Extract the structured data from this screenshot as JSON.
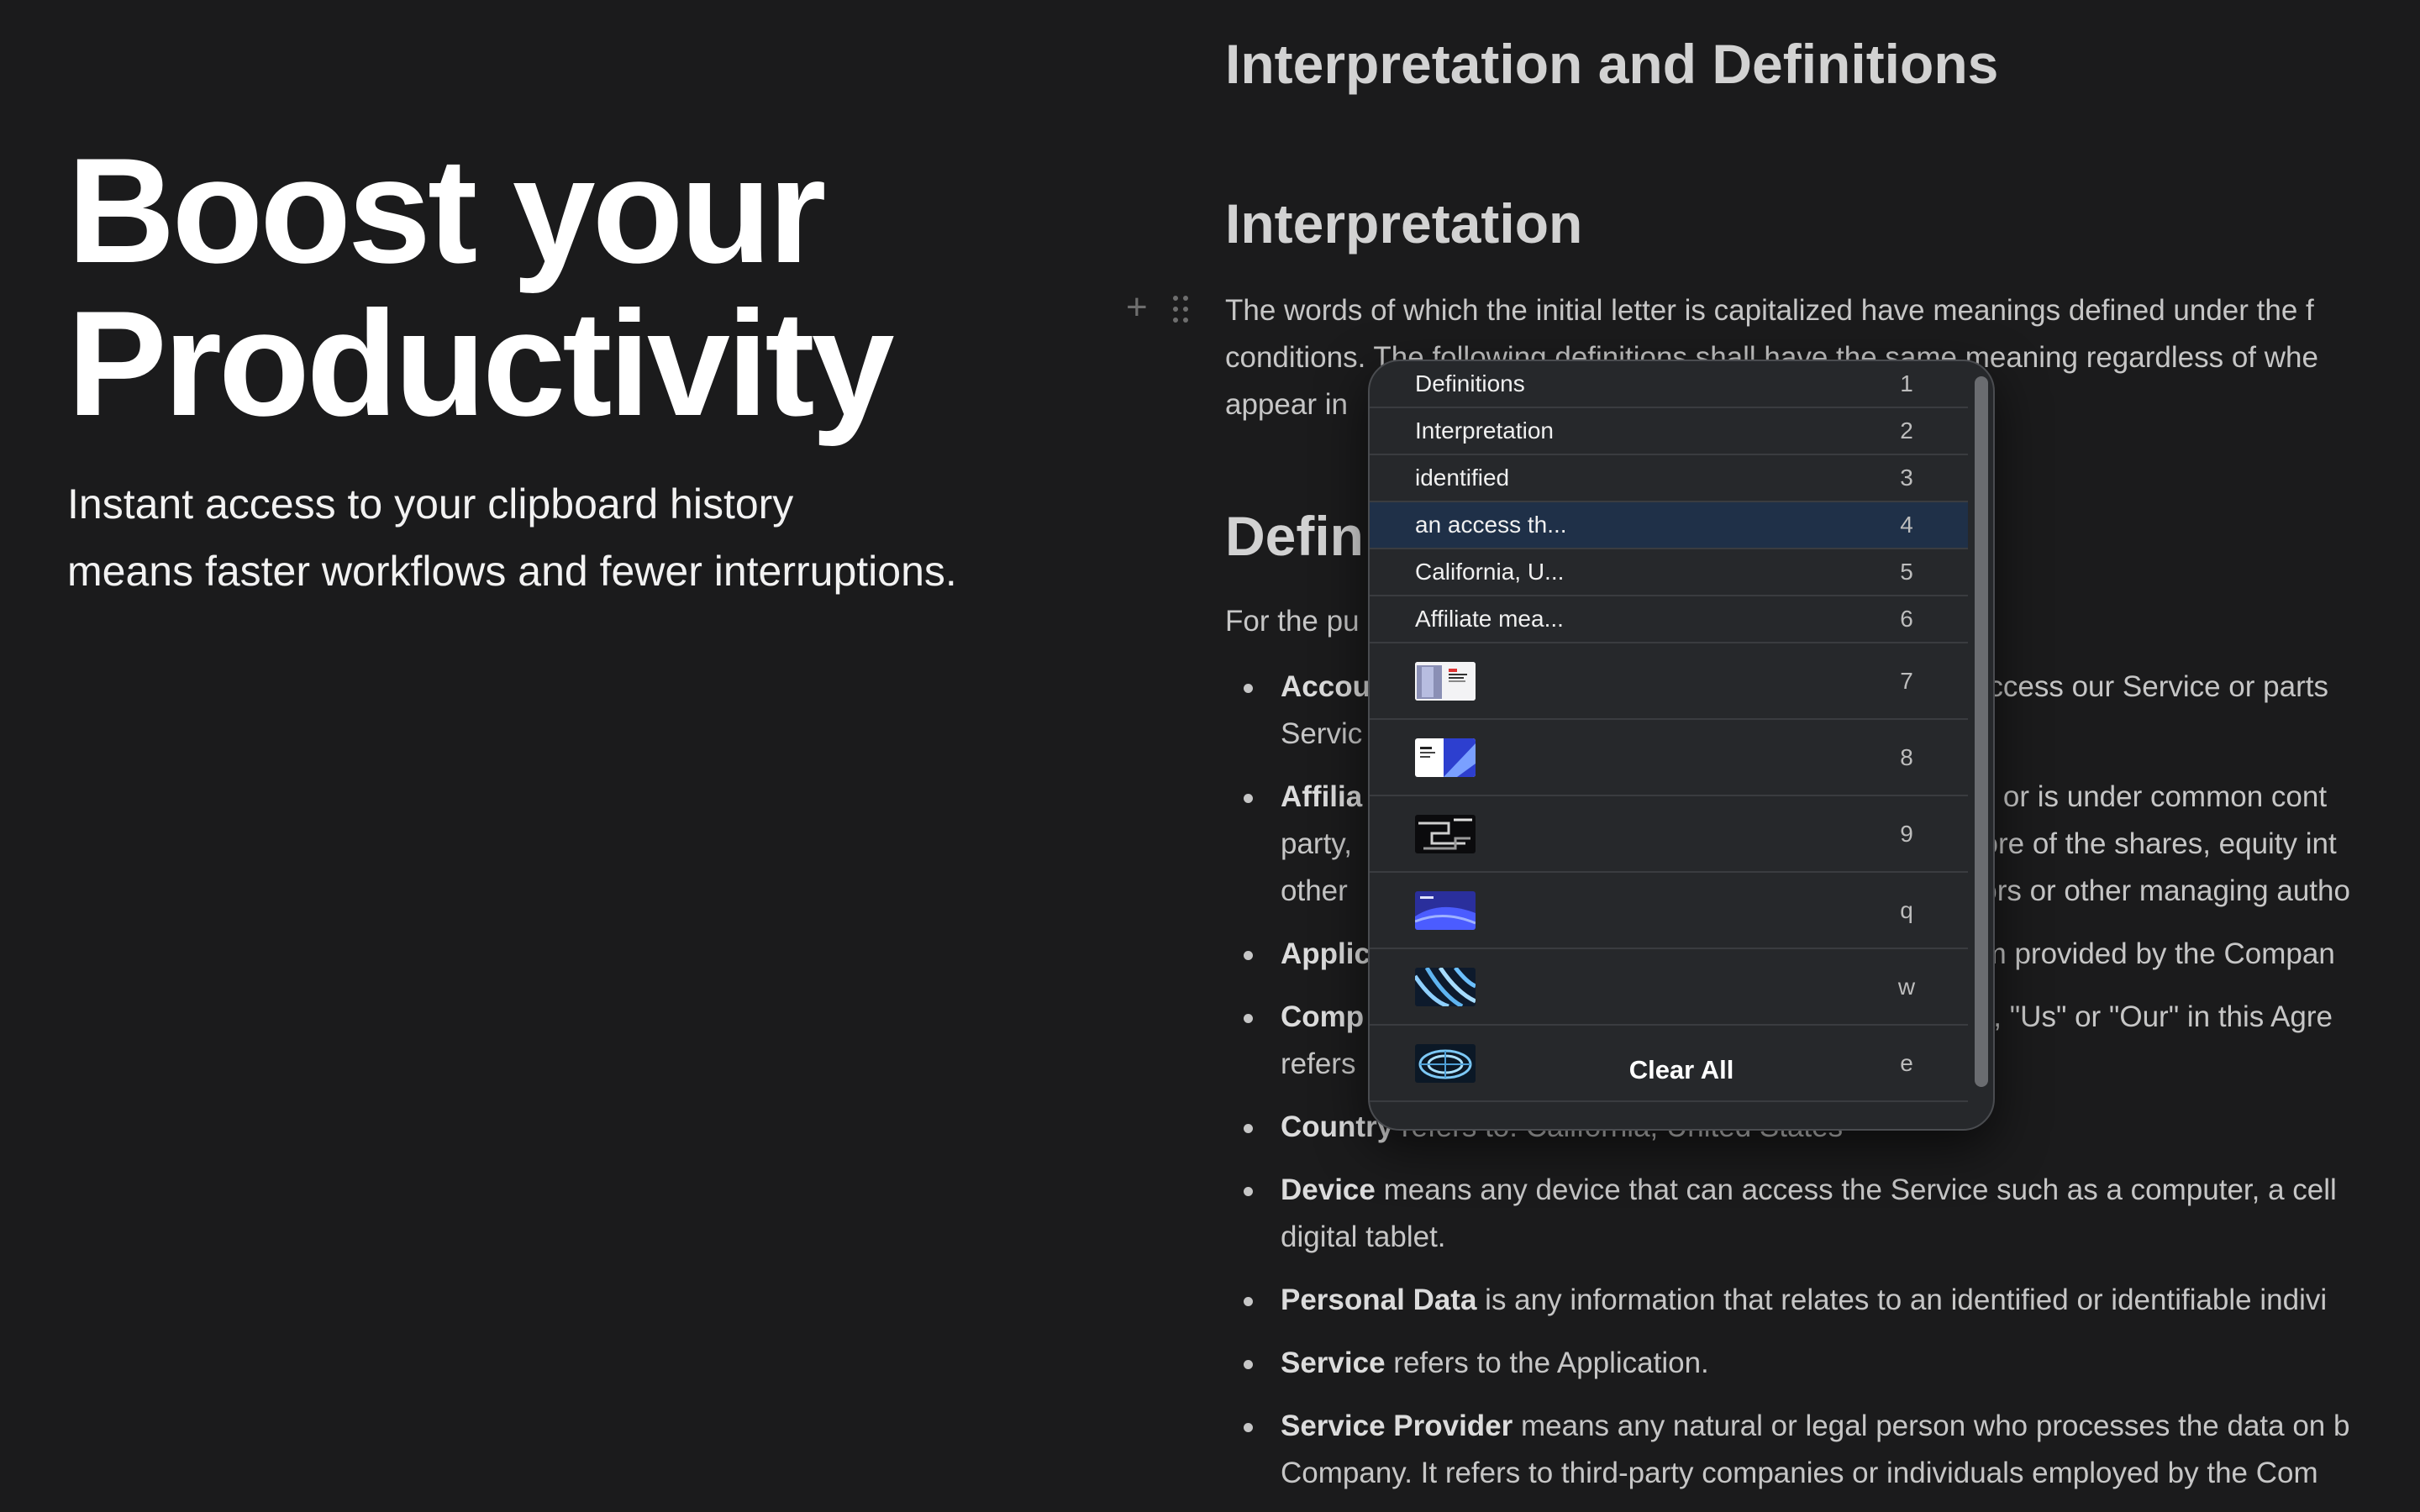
{
  "hero": {
    "title_line1": "Boost your",
    "title_line2": "Productivity",
    "subtitle_line1": "Instant access to your clipboard history",
    "subtitle_line2": "means faster workflows and fewer interruptions."
  },
  "doc": {
    "h1": "Interpretation and Definitions",
    "h2_interpretation": "Interpretation",
    "interpretation_lines": [
      "The words of which the initial letter is capitalized have meanings defined under the f",
      "conditions. The following definitions shall have the same meaning regardless of whe",
      "appear in"
    ],
    "h2_definitions": "Defin",
    "purposes_text": "For the pu",
    "items": [
      {
        "term": "Accou",
        "rest": "",
        "right": "to access our Service or parts",
        "line2": "Servic"
      },
      {
        "term": "Affilia",
        "rest": "",
        "right": "d by or is under common cont",
        "line2": "party,",
        "line2_right": "r more of the shares, equity int",
        "line3": "other",
        "line3_right": "ctors or other managing autho"
      },
      {
        "term": "Applic",
        "rest": "",
        "right": "gram provided by the Compan"
      },
      {
        "term": "Comp",
        "rest": "",
        "right": "We\", \"Us\" or \"Our\" in this Agre",
        "line2": "refers"
      },
      {
        "term": "Country",
        "rest": " refers to: California, United States"
      },
      {
        "term": "Device",
        "rest": " means any device that can access the Service such as a computer, a cell",
        "line2": "digital tablet."
      },
      {
        "term": "Personal Data",
        "rest": " is any information that relates to an identified or identifiable indivi"
      },
      {
        "term": "Service",
        "rest": " refers to the Application."
      },
      {
        "term": "Service Provider",
        "rest": " means any natural or legal person who processes the data on b",
        "line2": "Company. It refers to third-party companies or individuals employed by the Com"
      }
    ]
  },
  "clipboard": {
    "entries": [
      {
        "label": "Definitions",
        "key": "1"
      },
      {
        "label": "Interpretation",
        "key": "2"
      },
      {
        "label": "identified",
        "key": "3"
      },
      {
        "label": "an access th...",
        "key": "4",
        "selected": true
      },
      {
        "label": "California, U...",
        "key": "5"
      },
      {
        "label": "Affiliate mea...",
        "key": "6"
      }
    ],
    "image_entries": [
      {
        "key": "7",
        "thumb": "document-thumbnail"
      },
      {
        "key": "8",
        "thumb": "blue-wave-thumbnail"
      },
      {
        "key": "9",
        "thumb": "dark-pattern-thumbnail"
      },
      {
        "key": "q",
        "thumb": "purple-blue-thumbnail"
      },
      {
        "key": "w",
        "thumb": "blue-stripes-thumbnail"
      },
      {
        "key": "e",
        "thumb": "blue-mesh-thumbnail"
      }
    ],
    "clear_all_label": "Clear All",
    "selected_color": "#1f3048"
  }
}
